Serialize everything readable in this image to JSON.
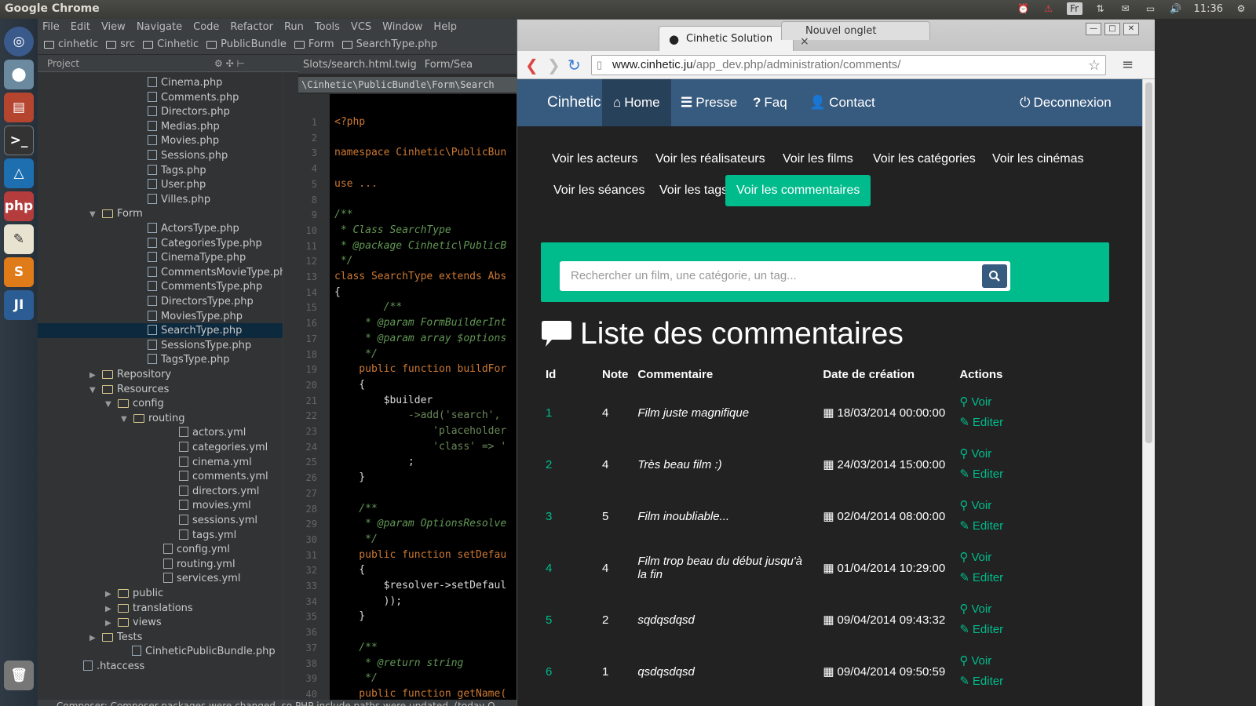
{
  "system_bar": {
    "app_title": "Google Chrome",
    "time": "11:36",
    "keyboard_layout": "Fr"
  },
  "launcher": {
    "items": [
      "ubuntu-logo-icon",
      "chrome-icon",
      "files-icon",
      "terminal-icon",
      "text-editor-icon",
      "phpstorm-icon",
      "notes-icon",
      "sublime-icon",
      "intellij-icon",
      "trash-icon"
    ]
  },
  "ide": {
    "menu": [
      "File",
      "Edit",
      "View",
      "Navigate",
      "Code",
      "Refactor",
      "Run",
      "Tools",
      "VCS",
      "Window",
      "Help"
    ],
    "breadcrumb": [
      "cinhetic",
      "src",
      "Cinhetic",
      "PublicBundle",
      "Form",
      "SearchType.php"
    ],
    "project_panel_label": "Project",
    "tree": [
      {
        "label": "Cinema.php",
        "indent": 1,
        "type": "php"
      },
      {
        "label": "Comments.php",
        "indent": 1,
        "type": "php"
      },
      {
        "label": "Directors.php",
        "indent": 1,
        "type": "php"
      },
      {
        "label": "Medias.php",
        "indent": 1,
        "type": "php"
      },
      {
        "label": "Movies.php",
        "indent": 1,
        "type": "php"
      },
      {
        "label": "Sessions.php",
        "indent": 1,
        "type": "php"
      },
      {
        "label": "Tags.php",
        "indent": 1,
        "type": "php"
      },
      {
        "label": "User.php",
        "indent": 1,
        "type": "php"
      },
      {
        "label": "Villes.php",
        "indent": 1,
        "type": "php"
      },
      {
        "label": "Form",
        "indent": 0,
        "type": "dir",
        "open": true
      },
      {
        "label": "ActorsType.php",
        "indent": 1,
        "type": "php"
      },
      {
        "label": "CategoriesType.php",
        "indent": 1,
        "type": "php"
      },
      {
        "label": "CinemaType.php",
        "indent": 1,
        "type": "php"
      },
      {
        "label": "CommentsMovieType.php",
        "indent": 1,
        "type": "php"
      },
      {
        "label": "CommentsType.php",
        "indent": 1,
        "type": "php"
      },
      {
        "label": "DirectorsType.php",
        "indent": 1,
        "type": "php"
      },
      {
        "label": "MoviesType.php",
        "indent": 1,
        "type": "php"
      },
      {
        "label": "SearchType.php",
        "indent": 1,
        "type": "php",
        "selected": true
      },
      {
        "label": "SessionsType.php",
        "indent": 1,
        "type": "php"
      },
      {
        "label": "TagsType.php",
        "indent": 1,
        "type": "php"
      },
      {
        "label": "Repository",
        "indent": 0,
        "type": "dir",
        "open": false
      },
      {
        "label": "Resources",
        "indent": 0,
        "type": "dir",
        "open": true
      },
      {
        "label": "config",
        "indent": 1,
        "type": "dir",
        "open": true
      },
      {
        "label": "routing",
        "indent": 2,
        "type": "dir",
        "open": true
      },
      {
        "label": "actors.yml",
        "indent": 3,
        "type": "yml"
      },
      {
        "label": "categories.yml",
        "indent": 3,
        "type": "yml"
      },
      {
        "label": "cinema.yml",
        "indent": 3,
        "type": "yml"
      },
      {
        "label": "comments.yml",
        "indent": 3,
        "type": "yml"
      },
      {
        "label": "directors.yml",
        "indent": 3,
        "type": "yml"
      },
      {
        "label": "movies.yml",
        "indent": 3,
        "type": "yml"
      },
      {
        "label": "sessions.yml",
        "indent": 3,
        "type": "yml"
      },
      {
        "label": "tags.yml",
        "indent": 3,
        "type": "yml"
      },
      {
        "label": "config.yml",
        "indent": 2,
        "type": "yml"
      },
      {
        "label": "routing.yml",
        "indent": 2,
        "type": "yml"
      },
      {
        "label": "services.yml",
        "indent": 2,
        "type": "yml"
      },
      {
        "label": "public",
        "indent": 1,
        "type": "dir",
        "open": false
      },
      {
        "label": "translations",
        "indent": 1,
        "type": "dir",
        "open": false
      },
      {
        "label": "views",
        "indent": 1,
        "type": "dir",
        "open": false
      },
      {
        "label": "Tests",
        "indent": 0,
        "type": "dir",
        "open": false
      },
      {
        "label": "CinheticPublicBundle.php",
        "indent": 0,
        "type": "php"
      },
      {
        "label": ".htaccess",
        "indent": -1,
        "type": "file"
      }
    ],
    "editor_tabs": [
      "Slots/search.html.twig",
      "Form/Sea"
    ],
    "editor_path": "\\Cinhetic\\PublicBundle\\Form\\Search",
    "code_lines": [
      {
        "n": "1",
        "t": "<?php"
      },
      {
        "n": "2",
        "t": ""
      },
      {
        "n": "3",
        "t": "namespace Cinhetic\\PublicBun"
      },
      {
        "n": "4",
        "t": ""
      },
      {
        "n": "5",
        "t": "use ..."
      },
      {
        "n": "8",
        "t": ""
      },
      {
        "n": "9",
        "t": "/**"
      },
      {
        "n": "10",
        "t": " * Class SearchType"
      },
      {
        "n": "11",
        "t": " * @package Cinhetic\\PublicB"
      },
      {
        "n": "12",
        "t": " */"
      },
      {
        "n": "13",
        "t": "class SearchType extends Abs"
      },
      {
        "n": "14",
        "t": "{"
      },
      {
        "n": "15",
        "t": "        /**"
      },
      {
        "n": "16",
        "t": "     * @param FormBuilderInt"
      },
      {
        "n": "17",
        "t": "     * @param array $options"
      },
      {
        "n": "18",
        "t": "     */"
      },
      {
        "n": "19",
        "t": "    public function buildFor"
      },
      {
        "n": "20",
        "t": "    {"
      },
      {
        "n": "21",
        "t": "        $builder"
      },
      {
        "n": "22",
        "t": "            ->add('search', "
      },
      {
        "n": "23",
        "t": "                'placeholder"
      },
      {
        "n": "24",
        "t": "                'class' => '"
      },
      {
        "n": "25",
        "t": "            ;"
      },
      {
        "n": "26",
        "t": "    }"
      },
      {
        "n": "27",
        "t": ""
      },
      {
        "n": "28",
        "t": "    /**"
      },
      {
        "n": "29",
        "t": "     * @param OptionsResolve"
      },
      {
        "n": "30",
        "t": "     */"
      },
      {
        "n": "31",
        "t": "    public function setDefau"
      },
      {
        "n": "32",
        "t": "    {"
      },
      {
        "n": "33",
        "t": "        $resolver->setDefaul"
      },
      {
        "n": "34",
        "t": "        ));"
      },
      {
        "n": "35",
        "t": "    }"
      },
      {
        "n": "36",
        "t": ""
      },
      {
        "n": "37",
        "t": "    /**"
      },
      {
        "n": "38",
        "t": "     * @return string"
      },
      {
        "n": "39",
        "t": "     */"
      },
      {
        "n": "40",
        "t": "    public function getName("
      }
    ],
    "status_message": "Composer: Composer packages were changed, so PHP include paths were updated. (today O"
  },
  "browser": {
    "tabs": [
      {
        "label": "Cinhetic Solution",
        "active": true
      },
      {
        "label": "Nouvel onglet",
        "active": false
      }
    ],
    "url_host": "www.cinhetic.ju",
    "url_path": "/app_dev.php/administration/comments/"
  },
  "site": {
    "brand": "Cinhetic",
    "nav": [
      {
        "label": "Home",
        "icon": "home-icon",
        "active": true
      },
      {
        "label": "Presse",
        "icon": "list-icon",
        "active": false
      },
      {
        "label": "Faq",
        "icon": "question-circle-icon",
        "active": false
      },
      {
        "label": "Contact",
        "icon": "user-icon",
        "active": false
      }
    ],
    "logout_label": "Deconnexion",
    "subnav": [
      {
        "label": "Voir les acteurs",
        "active": false
      },
      {
        "label": "Voir les réalisateurs",
        "active": false
      },
      {
        "label": "Voir les films",
        "active": false
      },
      {
        "label": "Voir les catégories",
        "active": false
      },
      {
        "label": "Voir les cinémas",
        "active": false
      },
      {
        "label": "Voir les séances",
        "active": false
      },
      {
        "label": "Voir les tags",
        "active": false
      },
      {
        "label": "Voir les commentaires",
        "active": true
      }
    ],
    "search_placeholder": "Rechercher un film, une catégorie, un tag...",
    "page_title": "Liste des commentaires",
    "table": {
      "headers": [
        "Id",
        "Note",
        "Commentaire",
        "Date de création",
        "Actions"
      ],
      "rows": [
        {
          "id": "1",
          "note": "4",
          "comment": "Film juste magnifique",
          "date": "18/03/2014 00:00:00"
        },
        {
          "id": "2",
          "note": "4",
          "comment": "Très beau film :)",
          "date": "24/03/2014 15:00:00"
        },
        {
          "id": "3",
          "note": "5",
          "comment": "Film inoubliable...",
          "date": "02/04/2014 08:00:00"
        },
        {
          "id": "4",
          "note": "4",
          "comment": "Film trop beau du début jusqu'à la fin",
          "date": "01/04/2014 10:29:00"
        },
        {
          "id": "5",
          "note": "2",
          "comment": "sqdqsdqsd",
          "date": "09/04/2014 09:43:32"
        },
        {
          "id": "6",
          "note": "1",
          "comment": "qsdqsdqsd",
          "date": "09/04/2014 09:50:59"
        }
      ],
      "view_label": "Voir",
      "edit_label": "Editer"
    }
  },
  "colors": {
    "accent": "#00bc8c",
    "navbar": "#375a7f",
    "page_bg": "#222222"
  }
}
